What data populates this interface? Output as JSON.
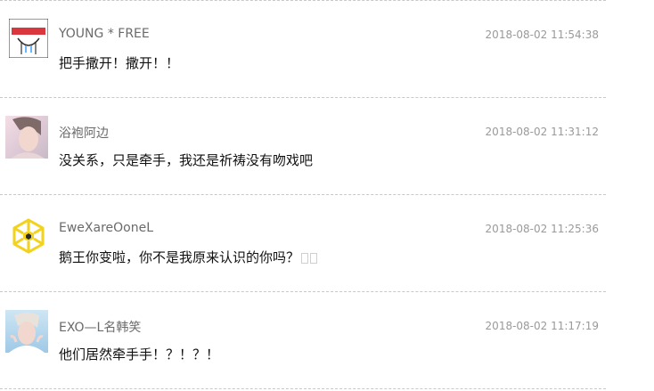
{
  "comments": [
    {
      "username": "YOUNG * FREE",
      "timestamp": "2018-08-02 11:54:38",
      "content": "把手撒开！撒开！！",
      "avatar_icon": "red-banner-face-icon"
    },
    {
      "username": "浴袍阿边",
      "timestamp": "2018-08-02 11:31:12",
      "content": "没关系，只是牵手，我还是祈祷没有吻戏吧",
      "avatar_icon": "person-photo-icon"
    },
    {
      "username": "EweXareOoneL",
      "timestamp": "2018-08-02 11:25:36",
      "content": "鹅王你变啦，你不是我原来认识的你吗？",
      "avatar_icon": "yellow-hexagon-logo-icon"
    },
    {
      "username": "EXO—L名韩笑",
      "timestamp": "2018-08-02 11:17:19",
      "content": "他们居然牵手手！？！？！",
      "avatar_icon": "person-photo-icon"
    }
  ],
  "colors": {
    "divider": "#c8c8c8",
    "username": "#6a6a6a",
    "timestamp": "#9a9a9a",
    "content": "#111111",
    "logo_yellow": "#f2d21b"
  }
}
